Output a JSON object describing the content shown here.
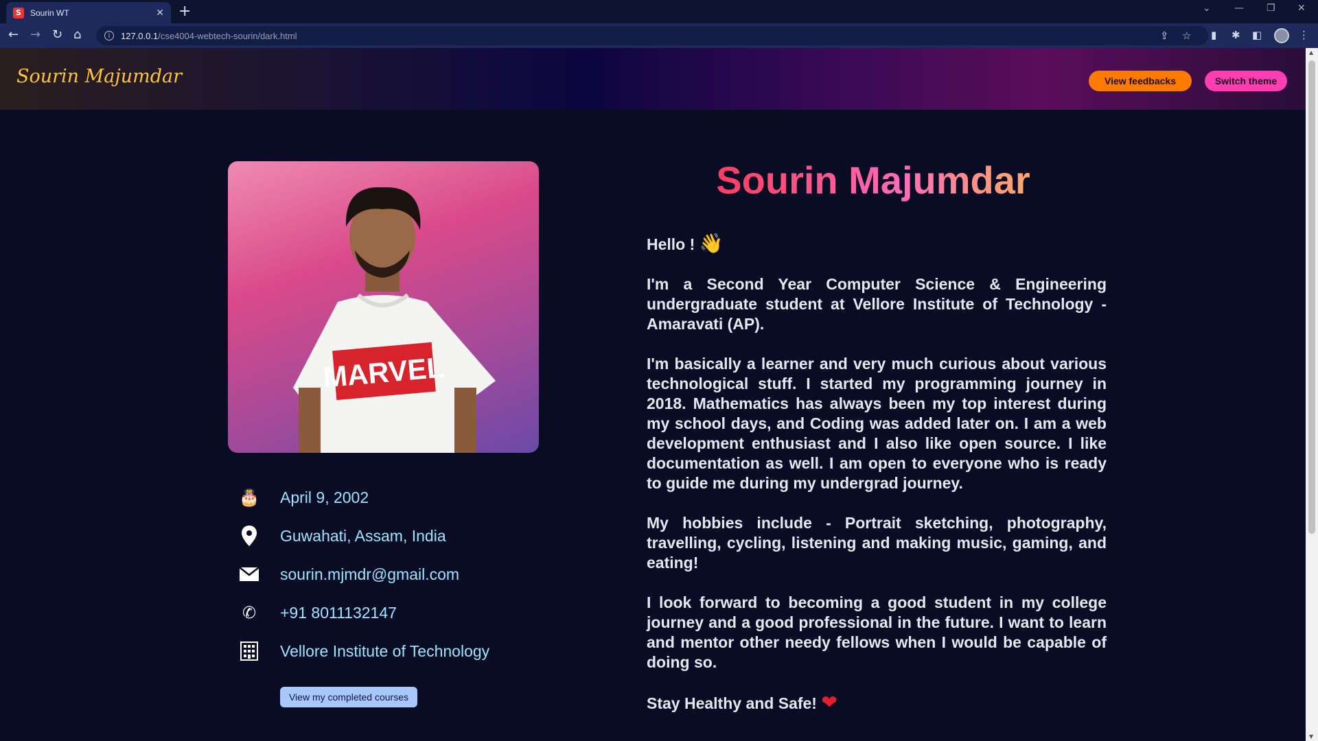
{
  "browser": {
    "tab_title": "Sourin WT",
    "tab_favicon_letter": "S",
    "url_host": "127.0.0.1",
    "url_path": "/cse4004-webtech-sourin/dark.html"
  },
  "header": {
    "logo": "Sourin Majumdar",
    "feedback_button": "View feedbacks",
    "theme_button": "Switch theme"
  },
  "profile": {
    "photo_shirt_text": "MARVEL",
    "birthday": "April 9, 2002",
    "location": "Guwahati, Assam, India",
    "email": "sourin.mjmdr@gmail.com",
    "phone": "+91 8011132147",
    "institute": "Vellore Institute of Technology",
    "courses_button": "View my completed courses"
  },
  "about": {
    "name": "Sourin Majumdar",
    "greeting": "Hello !",
    "paragraph1": "I'm a Second Year Computer Science & Engineering undergraduate student at Vellore Institute of Technology - Amaravati (AP).",
    "paragraph2": "I'm basically a learner and very much curious about various technological stuff. I started my programming journey in 2018. Mathematics has always been my top interest during my school days, and Coding was added later on. I am a web development enthusiast and I also like open source. I like documentation as well. I am open to everyone who is ready to guide me during my undergrad journey.",
    "paragraph3": "My hobbies include - Portrait sketching, photography, travelling, cycling, listening and making music, gaming, and eating!",
    "paragraph4": "I look forward to becoming a good student in my college journey and a good professional in the future. I want to learn and mentor other needy fellows when I would be capable of doing so.",
    "closing": "Stay Healthy and Safe!"
  },
  "colors": {
    "logo": "#ffc533",
    "feedback_button": "#ff7b00",
    "theme_button": "#ff3fb0",
    "info_text": "#9ee3ff",
    "page_background": "#080c24"
  },
  "icons": {
    "greeting": "waving-hand-icon",
    "closing": "heart-icon",
    "birthday": "cake-icon",
    "location": "map-pin-icon",
    "email": "envelope-icon",
    "phone": "phone-icon",
    "institute": "building-icon"
  }
}
